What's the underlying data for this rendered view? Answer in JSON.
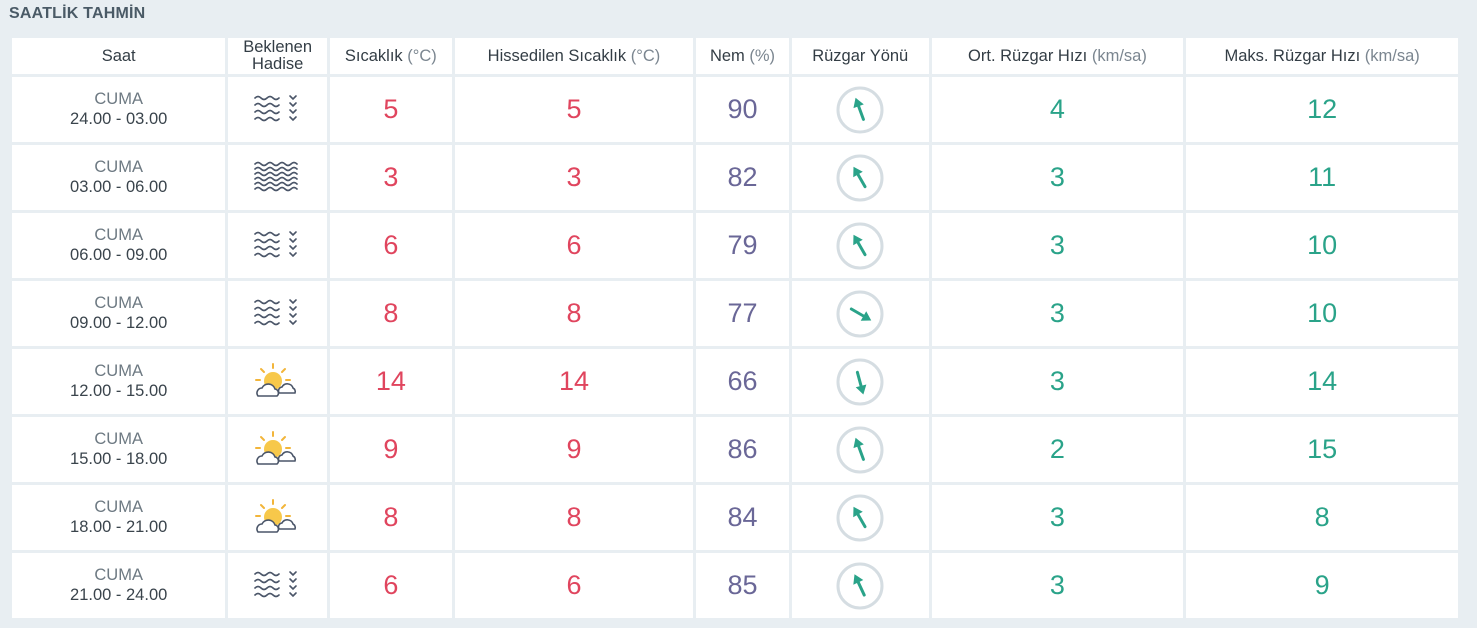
{
  "title": "SAATLİK TAHMİN",
  "headers": {
    "time": "Saat",
    "event": "Beklenen Hadise",
    "temp": "Sıcaklık",
    "temp_unit": "(°C)",
    "feels": "Hissedilen Sıcaklık",
    "feels_unit": "(°C)",
    "humidity": "Nem",
    "humidity_unit": "(%)",
    "wind_dir": "Rüzgar Yönü",
    "avg_wind": "Ort. Rüzgar Hızı",
    "avg_wind_unit": "(km/sa)",
    "max_wind": "Maks. Rüzgar Hızı",
    "max_wind_unit": "(km/sa)"
  },
  "colors": {
    "temperature": "#e0455e",
    "humidity": "#6a6797",
    "wind": "#2aa389",
    "background": "#e8eef2"
  },
  "rows": [
    {
      "day": "CUMA",
      "range": "24.00 - 03.00",
      "icon": "fog-icon",
      "temp": "5",
      "feels": "5",
      "humidity": "90",
      "wind_dir_deg": 340,
      "avg_wind": "4",
      "max_wind": "12"
    },
    {
      "day": "CUMA",
      "range": "03.00 - 06.00",
      "icon": "haze-icon",
      "temp": "3",
      "feels": "3",
      "humidity": "82",
      "wind_dir_deg": 330,
      "avg_wind": "3",
      "max_wind": "11"
    },
    {
      "day": "CUMA",
      "range": "06.00 - 09.00",
      "icon": "fog-icon",
      "temp": "6",
      "feels": "6",
      "humidity": "79",
      "wind_dir_deg": 330,
      "avg_wind": "3",
      "max_wind": "10"
    },
    {
      "day": "CUMA",
      "range": "09.00 - 12.00",
      "icon": "fog-icon",
      "temp": "8",
      "feels": "8",
      "humidity": "77",
      "wind_dir_deg": 120,
      "avg_wind": "3",
      "max_wind": "10"
    },
    {
      "day": "CUMA",
      "range": "12.00 - 15.00",
      "icon": "partly-cloudy-icon",
      "temp": "14",
      "feels": "14",
      "humidity": "66",
      "wind_dir_deg": 165,
      "avg_wind": "3",
      "max_wind": "14"
    },
    {
      "day": "CUMA",
      "range": "15.00 - 18.00",
      "icon": "partly-cloudy-icon",
      "temp": "9",
      "feels": "9",
      "humidity": "86",
      "wind_dir_deg": 340,
      "avg_wind": "2",
      "max_wind": "15"
    },
    {
      "day": "CUMA",
      "range": "18.00 - 21.00",
      "icon": "partly-cloudy-icon",
      "temp": "8",
      "feels": "8",
      "humidity": "84",
      "wind_dir_deg": 330,
      "avg_wind": "3",
      "max_wind": "8"
    },
    {
      "day": "CUMA",
      "range": "21.00 - 24.00",
      "icon": "fog-icon",
      "temp": "6",
      "feels": "6",
      "humidity": "85",
      "wind_dir_deg": 335,
      "avg_wind": "3",
      "max_wind": "9"
    }
  ]
}
